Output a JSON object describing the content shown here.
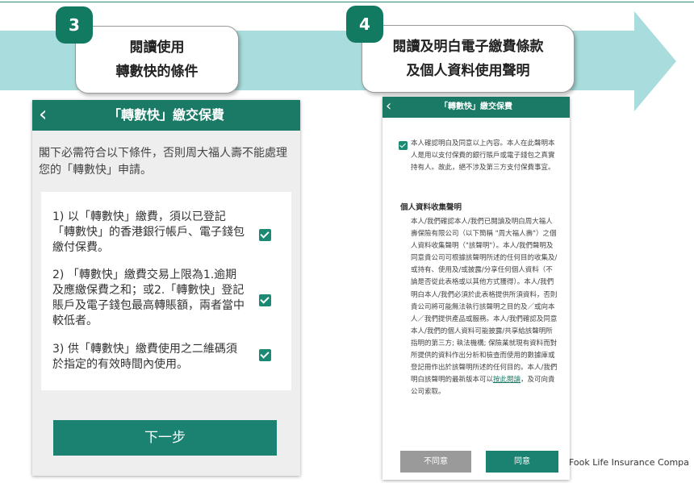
{
  "colors": {
    "brand": "#1b7a66",
    "arrow": "#a9dcdc",
    "badge": "#137a62",
    "disabled": "#9a9a9a"
  },
  "step3": {
    "number": "3",
    "line1": "閱讀使用",
    "line2": "轉數快的條件"
  },
  "step4": {
    "number": "4",
    "line1": "閱讀及明白電子繳費條款",
    "line2": "及個人資料使用聲明"
  },
  "left_screen": {
    "back_icon": "chevron-left-icon",
    "title": "「轉數快」繳交保費",
    "intro": "閣下必需符合以下條件，否則周大福人壽不能處理您的「轉數快」申請。",
    "conditions": [
      {
        "text": "1) 以「轉數快」繳費，須以已登記「轉數快」的香港銀行帳戶、電子錢包繳付保費。",
        "checked": true
      },
      {
        "text": "2) 「轉數快」繳費交易上限為1.逾期及應繳保費之和；或2.「轉數快」登記賬戶及電子錢包最高轉賬額，兩者當中較低者。",
        "checked": true
      },
      {
        "text": "3) 供「轉數快」繳費使用之二維碼須於指定的有效時間內使用。",
        "checked": true
      }
    ],
    "next_button": "下一步"
  },
  "right_screen": {
    "back_icon": "chevron-left-icon",
    "title": "「轉數快」繳交保費",
    "confirm_checked": true,
    "confirm_text": "本人確認明白及同意以上內容。本人在此聲明本人是用以支付保費的銀行賬戶或電子錢包之真實持有人。故此，絕不涉及第三方支付保費事宜。",
    "pi_heading": "個人資料收集聲明",
    "pi_body": "本人/我們確認本人/我們已閱讀及明白周大福人壽保險有限公司（以下簡稱 \"周大福人壽\"）之個人資料收集聲明（\"該聲明\"）。本人/我們聲明及同意貴公司可根據該聲明所述的任何目的收集及/或持有、使用及/或披露/分享任何個人資料（不論是否從此表格或以其他方式獲得）。本人/我們明白本人/我們必須於此表格提供所須資料，否則貴公司將可能無法執行該聲明之目的及／或向本人／我們提供產品或服務。本人/我們確認及同意本人/我們的個人資料可能披露/共享給該聲明所指明的第三方; 執法機構; 保險業就現有資料而對所提供的資料作出分析和檢查而使用的數據庫或登記冊作出於該聲明所述的任何目的。本人/我們明白該聲明的最新版本可以",
    "pi_link": "按此閱讀",
    "pi_tail": "，及可向貴公司索取。",
    "disagree_button": "不同意",
    "agree_button": "同意"
  },
  "footer_text": "Fook Life Insurance Compa"
}
